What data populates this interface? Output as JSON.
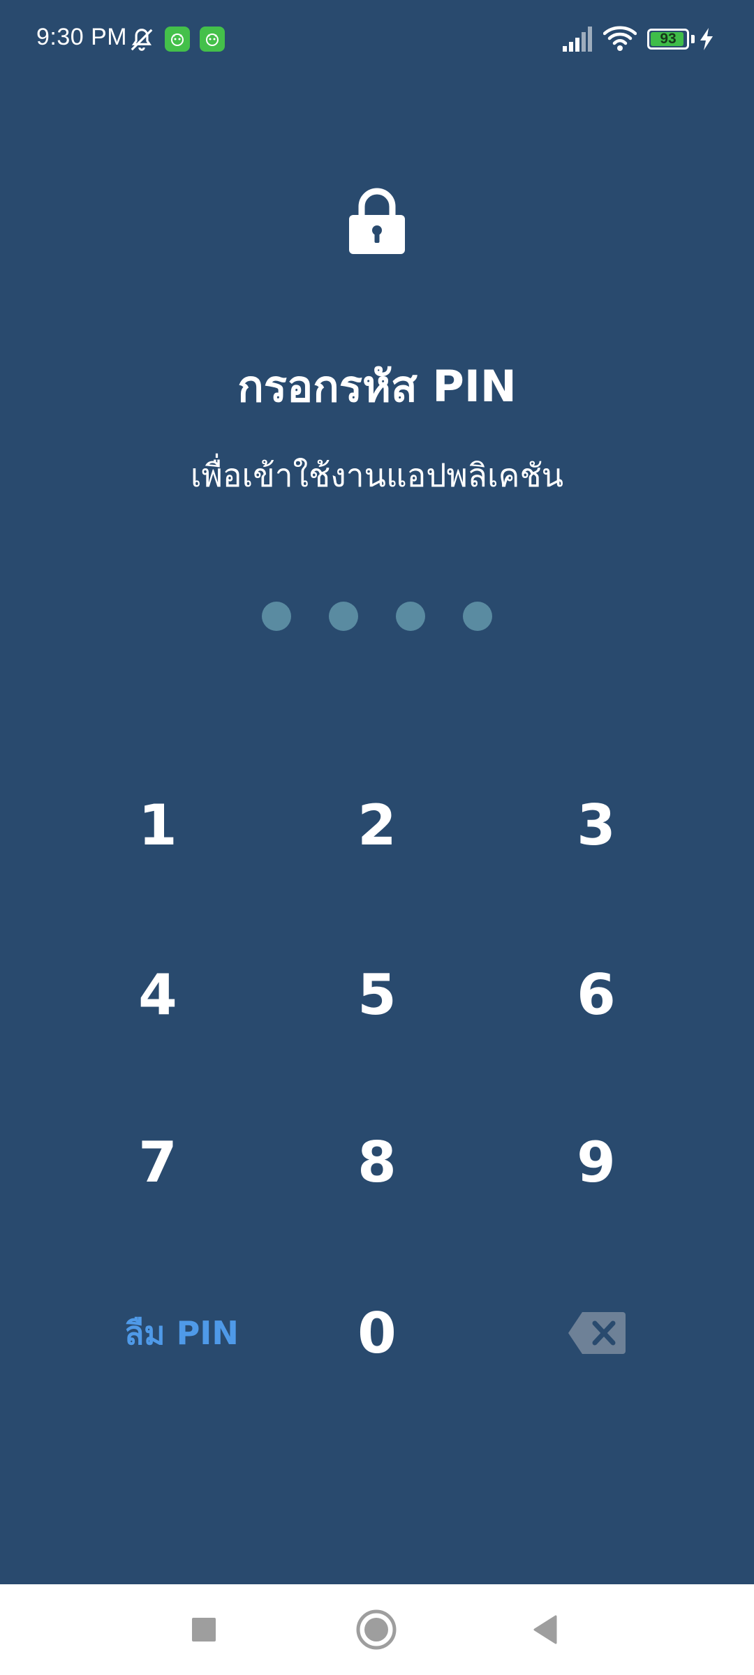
{
  "status_bar": {
    "time": "9:30 PM",
    "icons": [
      "bell-off-icon",
      "app-notification-icon",
      "app-notification-icon",
      "signal-icon",
      "wifi-icon",
      "battery-icon",
      "charging-icon"
    ],
    "battery_percent": "93",
    "battery_level": 0.93,
    "battery_color": "#3fbd49"
  },
  "header": {
    "icon": "lock-icon",
    "title": "กรอกรหัส PIN",
    "subtitle": "เพื่อเข้าใช้งานแอปพลิเคชัน"
  },
  "pin": {
    "length": 4,
    "entered": 0,
    "dot_color": "#5a8ba1"
  },
  "keypad": {
    "keys": [
      "1",
      "2",
      "3",
      "4",
      "5",
      "6",
      "7",
      "8",
      "9",
      "0"
    ],
    "forgot_label": "ลืม PIN",
    "backspace_icon": "backspace-icon"
  },
  "nav_bar": {
    "buttons": [
      "recents-icon",
      "home-icon",
      "back-icon"
    ]
  },
  "colors": {
    "background": "#294a6e",
    "accent": "#4f9ae8",
    "text": "#ffffff"
  }
}
